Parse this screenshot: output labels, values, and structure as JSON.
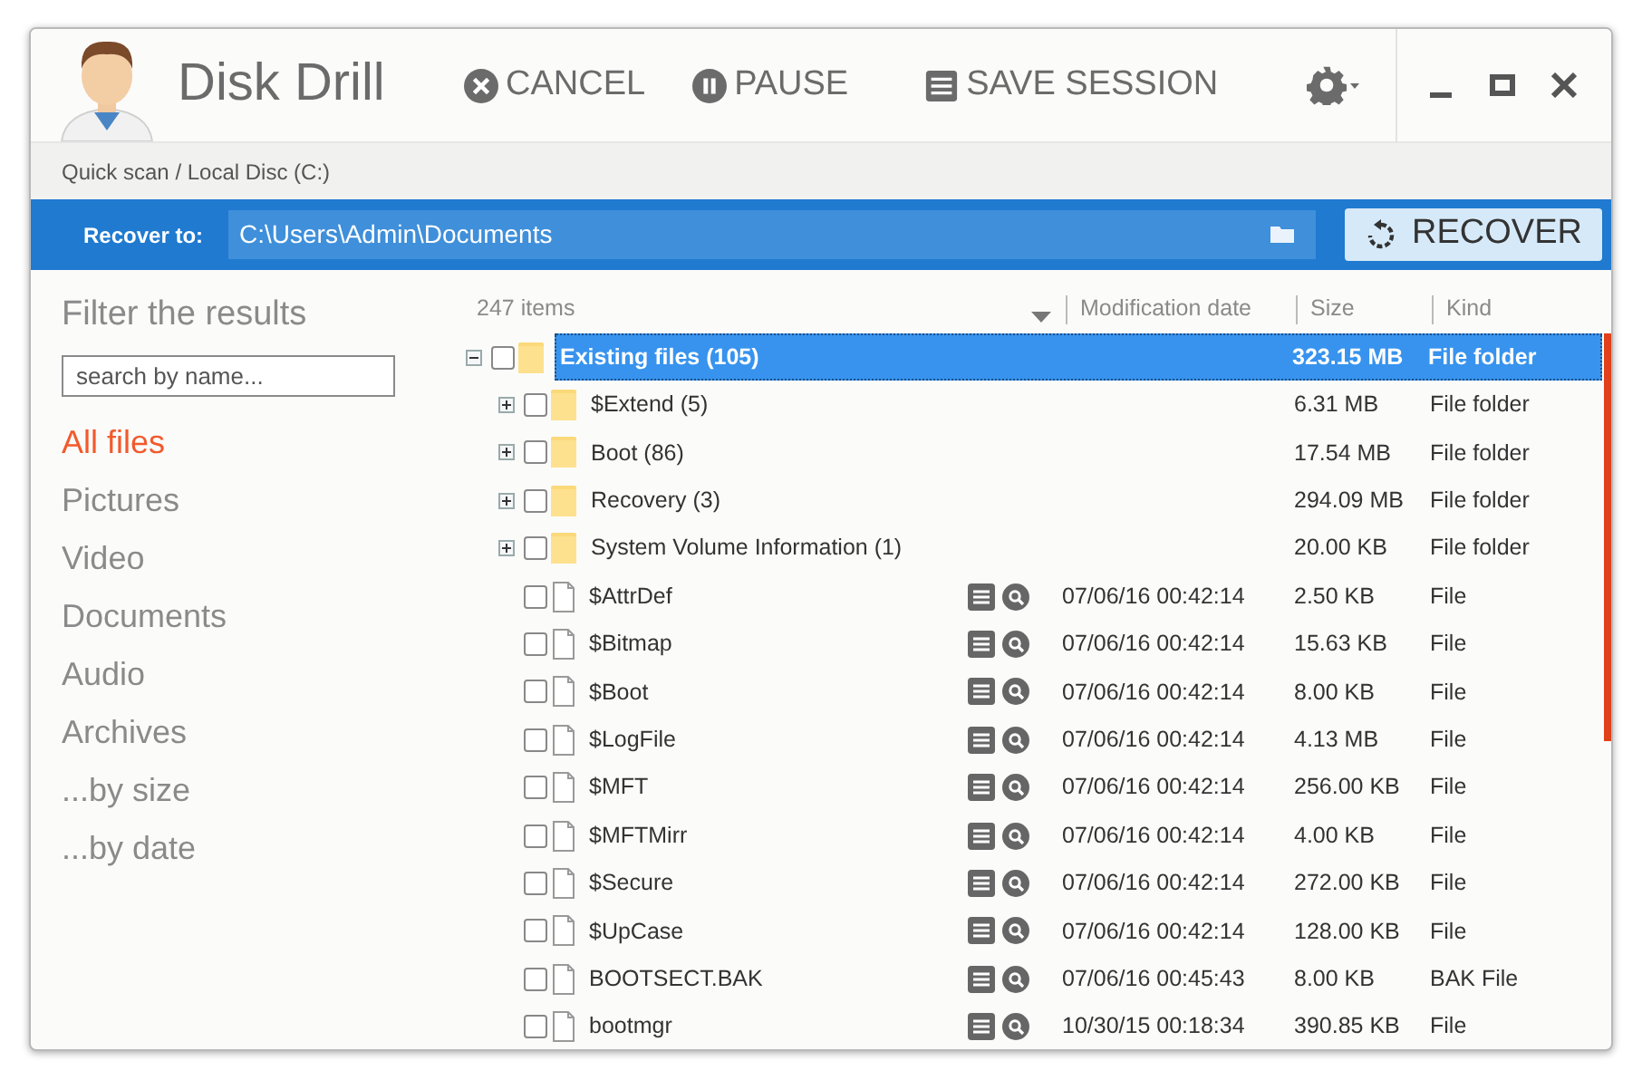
{
  "window": {
    "title": "Disk Drill"
  },
  "toolbar": [
    {
      "kind": "cancel",
      "label": "CANCEL"
    },
    {
      "kind": "pause",
      "label": "PAUSE"
    },
    {
      "kind": "save",
      "label": "SAVE SESSION"
    }
  ],
  "breadcrumb": "Quick scan / Local Disc (C:)",
  "recover_bar": {
    "label": "Recover to:",
    "path": "C:\\Users\\Admin\\Documents",
    "button": "RECOVER"
  },
  "sidebar": {
    "title": "Filter the results",
    "search": {
      "placeholder": "search by name..."
    },
    "filters": [
      {
        "label": "All files",
        "selected": true
      },
      {
        "label": "Pictures",
        "selected": false
      },
      {
        "label": "Video",
        "selected": false
      },
      {
        "label": "Documents",
        "selected": false
      },
      {
        "label": "Audio",
        "selected": false
      },
      {
        "label": "Archives",
        "selected": false
      },
      {
        "label": "...by size",
        "selected": false
      },
      {
        "label": "...by date",
        "selected": false
      }
    ]
  },
  "list": {
    "count": "247 items",
    "columns": [
      "Modification date",
      "Size",
      "Kind"
    ],
    "rows": [
      {
        "kind": "folder",
        "name": "Existing files (105)",
        "size": "323.15 MB",
        "file_kind": "File folder",
        "expanded": true,
        "checked": false,
        "selected": true,
        "children": [
          {
            "kind": "folder",
            "name": "$Extend (5)",
            "size": "6.31 MB",
            "file_kind": "File folder",
            "expanded": false,
            "checked": false,
            "selected": false
          },
          {
            "kind": "folder",
            "name": "Boot (86)",
            "size": "17.54 MB",
            "file_kind": "File folder",
            "expanded": false,
            "checked": false,
            "selected": false
          },
          {
            "kind": "folder",
            "name": "Recovery (3)",
            "size": "294.09 MB",
            "file_kind": "File folder",
            "expanded": false,
            "checked": false,
            "selected": false
          },
          {
            "kind": "folder",
            "name": "System Volume Information (1)",
            "size": "20.00 KB",
            "file_kind": "File folder",
            "expanded": false,
            "checked": false,
            "selected": false
          },
          {
            "kind": "file",
            "name": "$AttrDef",
            "date": "07/06/16 00:42:14",
            "size": "2.50 KB",
            "file_kind": "File",
            "checked": false,
            "selected": false
          },
          {
            "kind": "file",
            "name": "$Bitmap",
            "date": "07/06/16 00:42:14",
            "size": "15.63 KB",
            "file_kind": "File",
            "checked": false,
            "selected": false
          },
          {
            "kind": "file",
            "name": "$Boot",
            "date": "07/06/16 00:42:14",
            "size": "8.00 KB",
            "file_kind": "File",
            "checked": false,
            "selected": false
          },
          {
            "kind": "file",
            "name": "$LogFile",
            "date": "07/06/16 00:42:14",
            "size": "4.13 MB",
            "file_kind": "File",
            "checked": false,
            "selected": false
          },
          {
            "kind": "file",
            "name": "$MFT",
            "date": "07/06/16 00:42:14",
            "size": "256.00 KB",
            "file_kind": "File",
            "checked": false,
            "selected": false
          },
          {
            "kind": "file",
            "name": "$MFTMirr",
            "date": "07/06/16 00:42:14",
            "size": "4.00 KB",
            "file_kind": "File",
            "checked": false,
            "selected": false
          },
          {
            "kind": "file",
            "name": "$Secure",
            "date": "07/06/16 00:42:14",
            "size": "272.00 KB",
            "file_kind": "File",
            "checked": false,
            "selected": false
          },
          {
            "kind": "file",
            "name": "$UpCase",
            "date": "07/06/16 00:42:14",
            "size": "128.00 KB",
            "file_kind": "File",
            "checked": false,
            "selected": false
          },
          {
            "kind": "file",
            "name": "BOOTSECT.BAK",
            "date": "07/06/16 00:45:43",
            "size": "8.00 KB",
            "file_kind": "BAK File",
            "checked": false,
            "selected": false
          },
          {
            "kind": "file",
            "name": "bootmgr",
            "date": "10/30/15 00:18:34",
            "size": "390.85 KB",
            "file_kind": "File",
            "checked": false,
            "selected": false
          }
        ]
      }
    ]
  }
}
